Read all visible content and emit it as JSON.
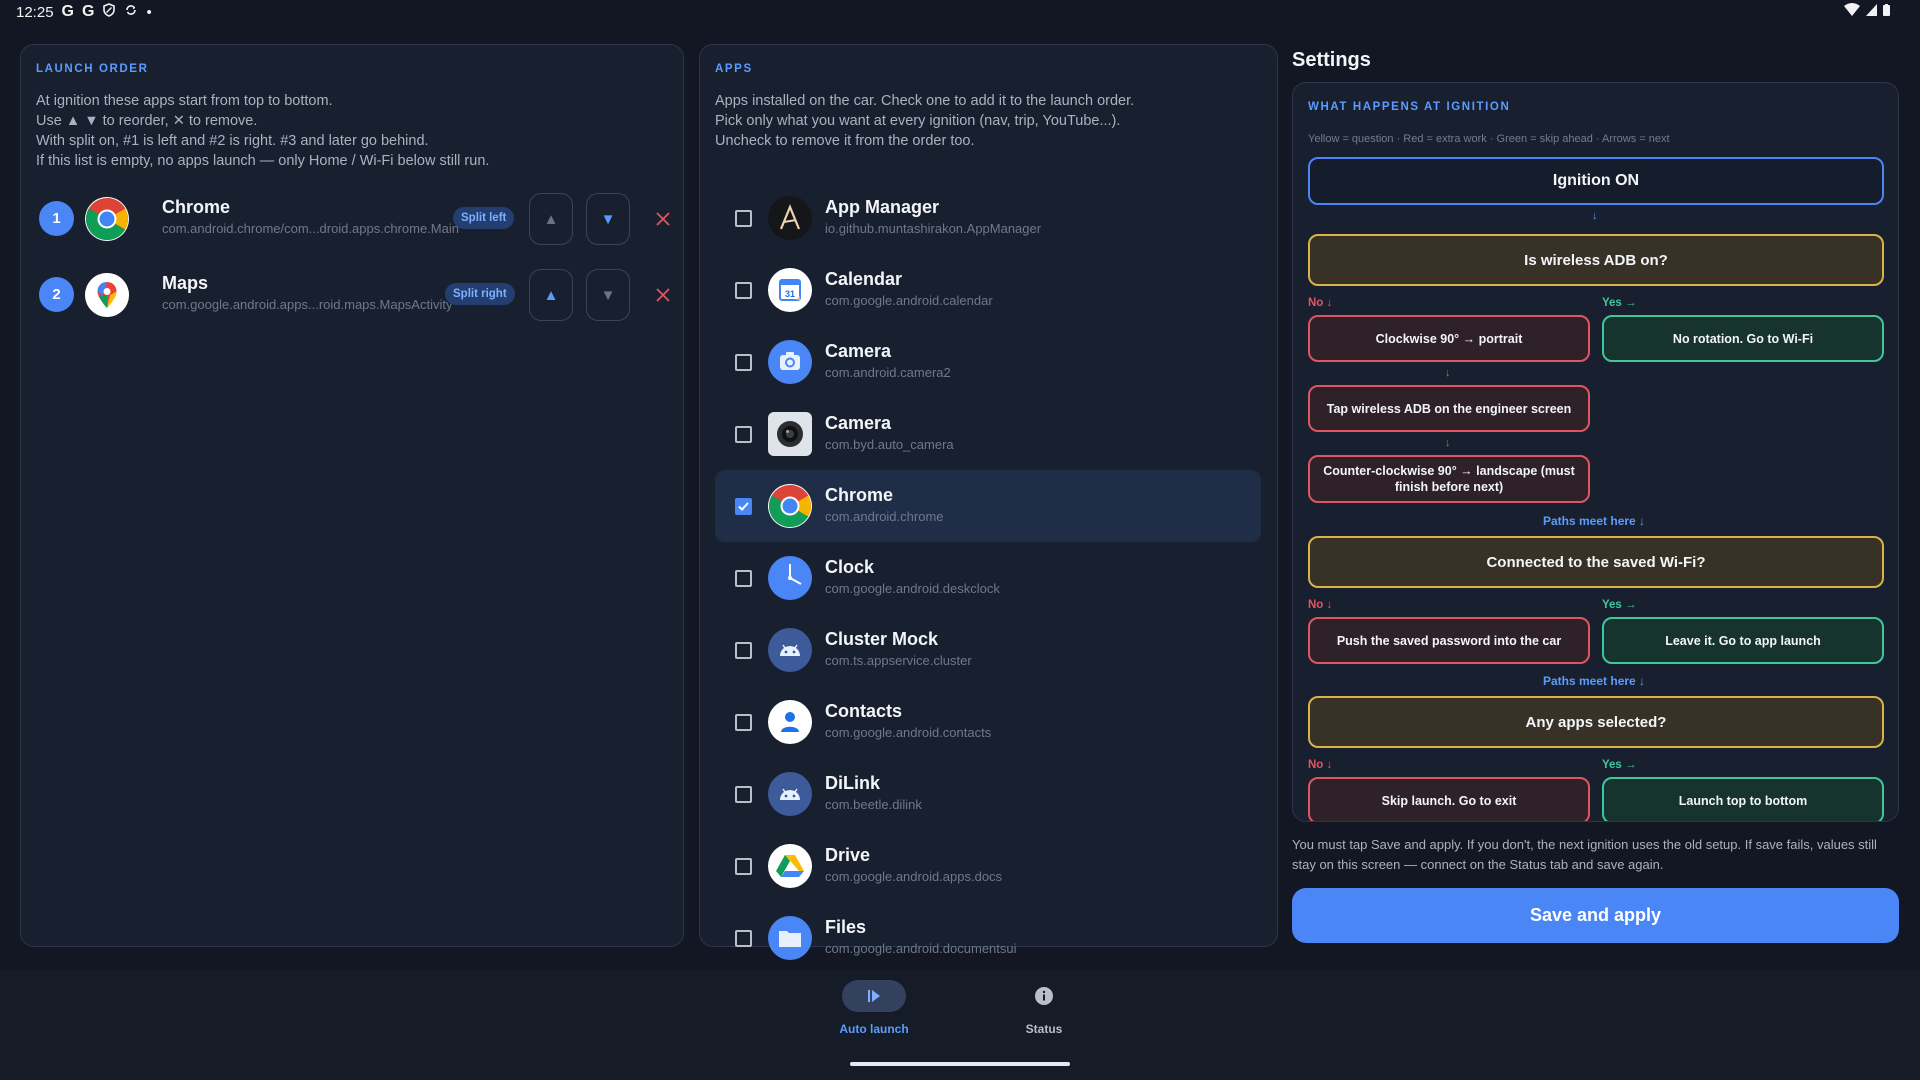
{
  "status_bar": {
    "time": "12:25",
    "g1": "G",
    "g2": "G",
    "dot": "•"
  },
  "launch_order": {
    "title": "LAUNCH ORDER",
    "desc": [
      "At ignition these apps start from top to bottom.",
      "Use ▲ ▼ to reorder, ✕ to remove.",
      "With split on, #1 is left and #2 is right. #3 and later go behind.",
      "If this list is empty, no apps launch — only Home / Wi-Fi below still run."
    ],
    "items": [
      {
        "num": "1",
        "name": "Chrome",
        "pkg": "com.android.chrome/com...droid.apps.chrome.Main",
        "split": "Split left",
        "up": "▲",
        "down": "▼",
        "remove": "✕"
      },
      {
        "num": "2",
        "name": "Maps",
        "pkg": "com.google.android.apps...roid.maps.MapsActivity",
        "split": "Split right",
        "up": "▲",
        "down": "▼",
        "remove": "✕"
      }
    ]
  },
  "apps": {
    "title": "APPS",
    "desc": [
      "Apps installed on the car. Check one to add it to the launch order.",
      "Pick only what you want at every ignition (nav, trip, YouTube...).",
      "Uncheck to remove it from the order too."
    ],
    "items": [
      {
        "name": "App Manager",
        "pkg": "io.github.muntashirakon.AppManager",
        "checked": false,
        "icon": "app-manager-icon"
      },
      {
        "name": "Calendar",
        "pkg": "com.google.android.calendar",
        "checked": false,
        "icon": "calendar-icon",
        "cal_day": "31"
      },
      {
        "name": "Camera",
        "pkg": "com.android.camera2",
        "checked": false,
        "icon": "camera-icon"
      },
      {
        "name": "Camera",
        "pkg": "com.byd.auto_camera",
        "checked": false,
        "icon": "camera-lens-icon"
      },
      {
        "name": "Chrome",
        "pkg": "com.android.chrome",
        "checked": true,
        "icon": "chrome-icon"
      },
      {
        "name": "Clock",
        "pkg": "com.google.android.deskclock",
        "checked": false,
        "icon": "clock-icon"
      },
      {
        "name": "Cluster Mock",
        "pkg": "com.ts.appservice.cluster",
        "checked": false,
        "icon": "android-icon"
      },
      {
        "name": "Contacts",
        "pkg": "com.google.android.contacts",
        "checked": false,
        "icon": "contacts-icon"
      },
      {
        "name": "DiLink",
        "pkg": "com.beetle.dilink",
        "checked": false,
        "icon": "android-icon"
      },
      {
        "name": "Drive",
        "pkg": "com.google.android.apps.docs",
        "checked": false,
        "icon": "drive-icon"
      },
      {
        "name": "Files",
        "pkg": "com.google.android.documentsui",
        "checked": false,
        "icon": "files-icon"
      }
    ]
  },
  "settings": {
    "title": "Settings",
    "flow_title": "WHAT HAPPENS AT IGNITION",
    "legend": "Yellow = question · Red = extra work · Green = skip ahead · Arrows = next",
    "ignition": "Ignition ON",
    "arrow_down": "↓",
    "q1": "Is wireless ADB on?",
    "no_label": "No ↓",
    "yes_label": "Yes →",
    "q1_no": "Clockwise 90° → portrait",
    "q1_yes": "No rotation. Go to Wi-Fi",
    "q1_no_step2": "Tap wireless ADB on the engineer screen",
    "q1_no_step3": "Counter-clockwise 90° → landscape (must finish before next)",
    "paths_meet": "Paths meet here ↓",
    "q2": "Connected to the saved Wi-Fi?",
    "q2_no": "Push the saved password into the car",
    "q2_yes": "Leave it. Go to app launch",
    "q3": "Any apps selected?",
    "q3_no": "Skip launch. Go to exit",
    "q3_yes": "Launch top to bottom",
    "save_note": "You must tap Save and apply. If you don't, the next ignition uses the old setup. If save fails, values still stay on this screen — connect on the Status tab and save again.",
    "save_button": "Save and apply"
  },
  "nav": {
    "auto_launch": "Auto launch",
    "status": "Status"
  },
  "colors": {
    "accent": "#4a86f5",
    "question": "#d9b248",
    "extra_work": "#e05560",
    "skip_ahead": "#3fc79a"
  }
}
